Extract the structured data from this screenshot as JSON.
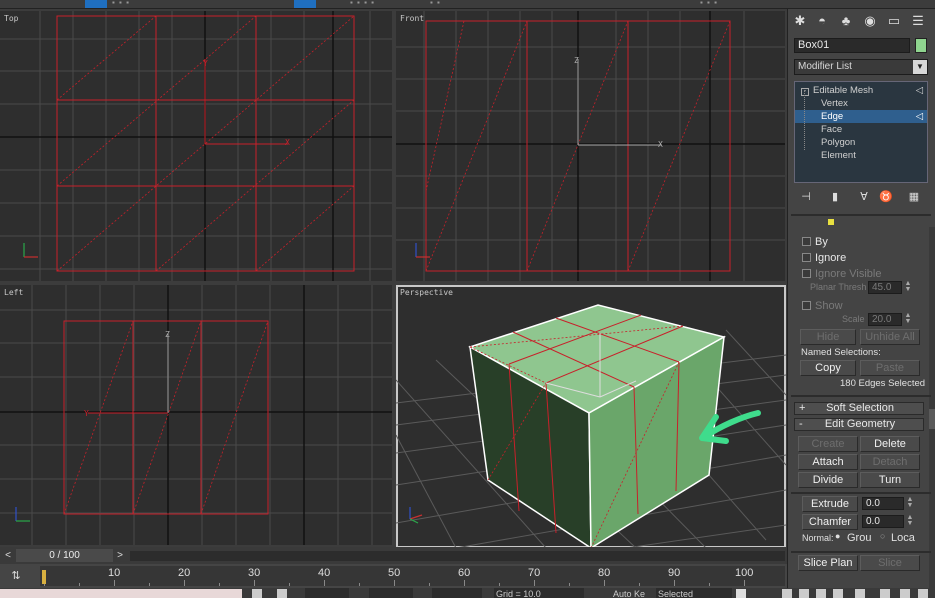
{
  "viewports": {
    "top": {
      "label": "Top"
    },
    "front": {
      "label": "Front"
    },
    "left": {
      "label": "Left"
    },
    "perspective": {
      "label": "Perspective"
    }
  },
  "panel": {
    "object_name": "Box01",
    "object_color": "#8fd48f",
    "modifier_list": "Modifier List",
    "stack": [
      {
        "label": "Editable Mesh",
        "selected": false
      },
      {
        "label": "Vertex",
        "selected": false
      },
      {
        "label": "Edge",
        "selected": true
      },
      {
        "label": "Face",
        "selected": false
      },
      {
        "label": "Polygon",
        "selected": false
      },
      {
        "label": "Element",
        "selected": false
      }
    ],
    "selection": {
      "by_label": "By",
      "ignore_label": "Ignore",
      "ignore_visible_label": "Ignore Visible",
      "planar_thresh_label": "Planar Thresh",
      "planar_thresh_value": "45.0",
      "show_label": "Show",
      "scale_label": "Scale",
      "scale_value": "20.0",
      "hide_label": "Hide",
      "unhide_all_label": "Unhide All",
      "named_selections_label": "Named Selections:",
      "copy_label": "Copy",
      "paste_label": "Paste",
      "selected_info": "180 Edges Selected"
    },
    "soft_selection": {
      "sign": "+",
      "title": "Soft Selection"
    },
    "edit_geometry": {
      "sign": "-",
      "title": "Edit Geometry",
      "create_label": "Create",
      "delete_label": "Delete",
      "attach_label": "Attach",
      "detach_label": "Detach",
      "divide_label": "Divide",
      "turn_label": "Turn",
      "extrude_label": "Extrude",
      "extrude_value": "0.0",
      "chamfer_label": "Chamfer",
      "chamfer_value": "0.0",
      "normal_label": "Normal:",
      "group_label": "Grou",
      "local_label": "Loca",
      "slice_plane_label": "Slice Plan",
      "slice_label": "Slice"
    }
  },
  "time_slider": {
    "value": "0 / 100",
    "prev": "<",
    "next": ">"
  },
  "timeline": {
    "ticks": [
      "10",
      "20",
      "30",
      "40",
      "50",
      "60",
      "70",
      "80",
      "90",
      "100"
    ]
  },
  "status": {
    "grid": "Grid = 10.0",
    "auto_key": "Auto Ke",
    "selected": "Selected"
  },
  "colors": {
    "wire": "#c8202a",
    "box": "#8cc48c",
    "grid": "#4a4a4a",
    "viewport_bg": "#2e2e2e"
  }
}
